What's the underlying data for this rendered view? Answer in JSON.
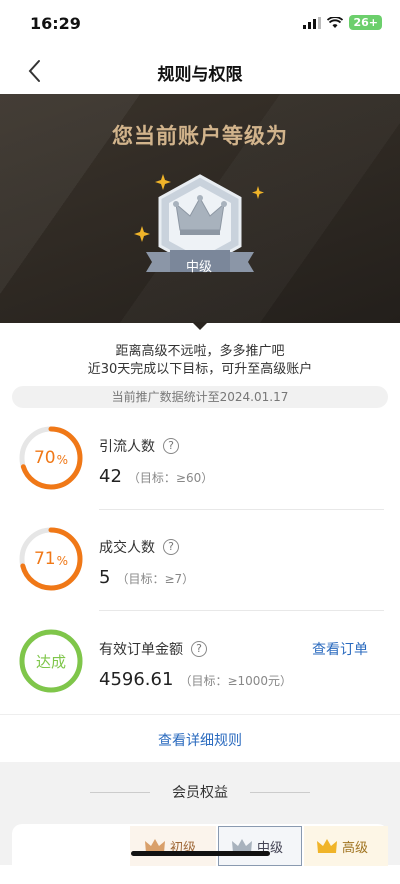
{
  "status_bar": {
    "time": "16:29",
    "battery": "26+"
  },
  "nav": {
    "title": "规则与权限",
    "back_icon": "chevron-left-icon"
  },
  "hero": {
    "heading": "您当前账户等级为",
    "level": "中级"
  },
  "hints": {
    "line1": "距离高级不远啦，多多推广吧",
    "line2": "近30天完成以下目标，可升至高级账户"
  },
  "stat_date": "当前推广数据统计至2024.01.17",
  "metrics": [
    {
      "title": "引流人数",
      "value": "42",
      "target": "（目标：≥60）",
      "progress_label": "70",
      "unit": "%",
      "progress": 0.7,
      "color": "#f07817"
    },
    {
      "title": "成交人数",
      "value": "5",
      "target": "（目标：≥7）",
      "progress_label": "71",
      "unit": "%",
      "progress": 0.71,
      "color": "#f07817"
    },
    {
      "title": "有效订单金额",
      "value": "4596.61",
      "target": "（目标：≥1000元）",
      "progress_label": "达成",
      "progress": 1.0,
      "color": "#7fc64a",
      "action": "查看订单"
    }
  ],
  "rules_link": "查看详细规则",
  "benefits": {
    "title": "会员权益",
    "tiers": [
      "初级",
      "中级",
      "高级"
    ]
  },
  "colors": {
    "accent": "#2b6bbf",
    "hero_bg": "#2f2a24",
    "gold": "#d2b48c"
  }
}
